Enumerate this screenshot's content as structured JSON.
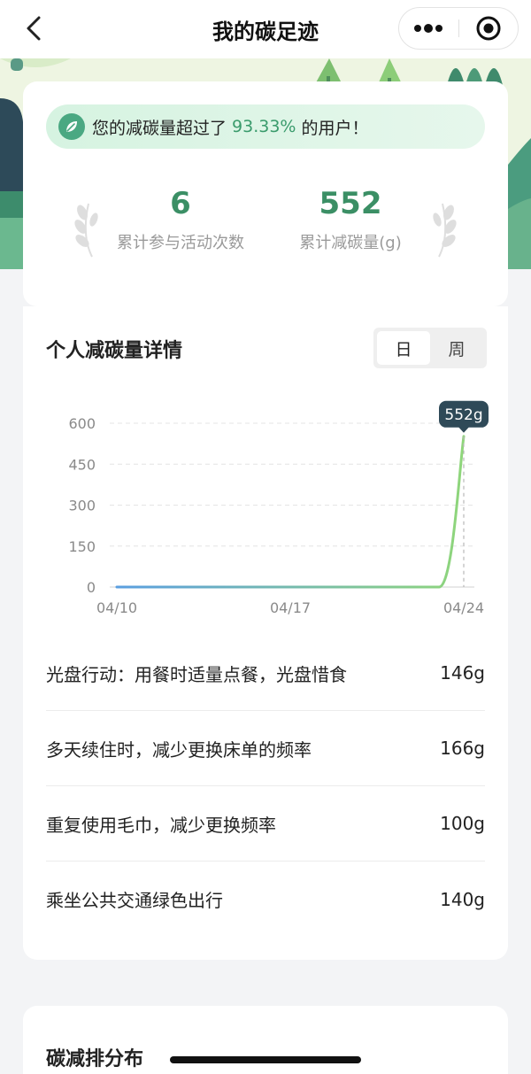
{
  "header": {
    "title": "我的碳足迹",
    "icons": {
      "back": "chevron-left-icon",
      "more": "more-dots-icon",
      "close": "record-target-icon"
    }
  },
  "summary": {
    "banner": {
      "prefix": "您的减碳量超过了",
      "percent": "93.33%",
      "suffix": "的用户！",
      "icon": "leaf-icon"
    },
    "stats": [
      {
        "value": "6",
        "label": "累计参与活动次数"
      },
      {
        "value": "552",
        "label": "累计减碳量(g)"
      }
    ]
  },
  "detail": {
    "title": "个人减碳量详情",
    "toggle": {
      "options": [
        "日",
        "周"
      ],
      "selected": "日"
    },
    "chart_data": {
      "type": "line",
      "x": [
        "04/10",
        "04/11",
        "04/12",
        "04/13",
        "04/14",
        "04/15",
        "04/16",
        "04/17",
        "04/18",
        "04/19",
        "04/20",
        "04/21",
        "04/22",
        "04/23",
        "04/24"
      ],
      "series": [
        {
          "values": [
            0,
            0,
            0,
            0,
            0,
            0,
            0,
            0,
            0,
            0,
            0,
            0,
            0,
            0,
            552
          ]
        }
      ],
      "x_tick_labels": [
        "04/10",
        "04/17",
        "04/24"
      ],
      "y_ticks": [
        0,
        150,
        300,
        450,
        600
      ],
      "ylim": [
        0,
        600
      ],
      "highlight": {
        "index": 14,
        "label": "552g"
      },
      "grid": true,
      "colors": {
        "line_start": "#5a9ee0",
        "line_end": "#8fd67a",
        "tooltip": "#2f4a58"
      }
    },
    "activities": [
      {
        "name": "光盘行动：用餐时适量点餐，光盘惜食",
        "value": "146g"
      },
      {
        "name": "多天续住时，减少更换床单的频率",
        "value": "166g"
      },
      {
        "name": "重复使用毛巾，减少更换频率",
        "value": "100g"
      },
      {
        "name": "乘坐公共交通绿色出行",
        "value": "140g"
      }
    ]
  },
  "ranking": {
    "title": "碳减排分布"
  }
}
